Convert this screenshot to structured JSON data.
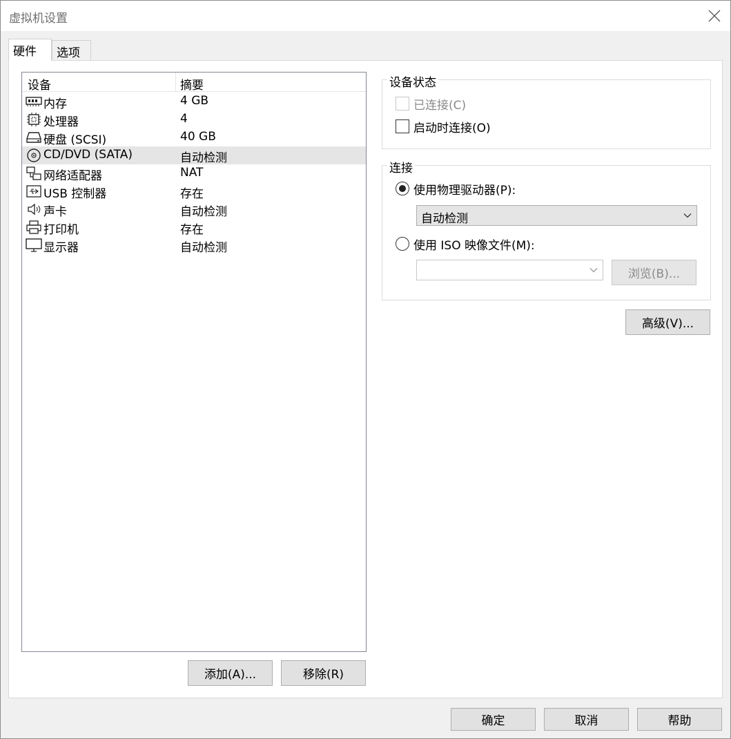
{
  "window": {
    "title": "虚拟机设置"
  },
  "tabs": [
    {
      "label": "硬件"
    },
    {
      "label": "选项"
    }
  ],
  "device_list": {
    "col_device": "设备",
    "col_summary": "摘要",
    "rows": [
      {
        "name": "内存",
        "summary": "4 GB",
        "icon": "memory-icon"
      },
      {
        "name": "处理器",
        "summary": "4",
        "icon": "processor-icon"
      },
      {
        "name": "硬盘 (SCSI)",
        "summary": "40 GB",
        "icon": "hard-disk-icon"
      },
      {
        "name": "CD/DVD (SATA)",
        "summary": "自动检测",
        "icon": "cd-dvd-icon"
      },
      {
        "name": "网络适配器",
        "summary": "NAT",
        "icon": "network-adapter-icon"
      },
      {
        "name": "USB 控制器",
        "summary": "存在",
        "icon": "usb-icon"
      },
      {
        "name": "声卡",
        "summary": "自动检测",
        "icon": "speaker-icon"
      },
      {
        "name": "打印机",
        "summary": "存在",
        "icon": "printer-icon"
      },
      {
        "name": "显示器",
        "summary": "自动检测",
        "icon": "monitor-icon"
      }
    ],
    "selected_index": 3
  },
  "buttons": {
    "add": "添加(A)...",
    "remove": "移除(R)",
    "advanced": "高级(V)...",
    "browse": "浏览(B)...",
    "ok": "确定",
    "cancel": "取消",
    "help": "帮助"
  },
  "device_status": {
    "title": "设备状态",
    "connected_label": "已连接(C)",
    "connected_checked": false,
    "connected_enabled": false,
    "connect_at_power_on_label": "启动时连接(O)",
    "connect_at_power_on_checked": false
  },
  "connection": {
    "title": "连接",
    "use_physical_label": "使用物理驱动器(P):",
    "use_physical_selected": true,
    "physical_drive_value": "自动检测",
    "use_iso_label": "使用 ISO 映像文件(M):",
    "use_iso_selected": false,
    "iso_path_value": ""
  },
  "colors": {
    "selected_row": "#e5e5e5",
    "button_face": "#e1e1e1",
    "disabled_text": "#8a8a8a"
  }
}
